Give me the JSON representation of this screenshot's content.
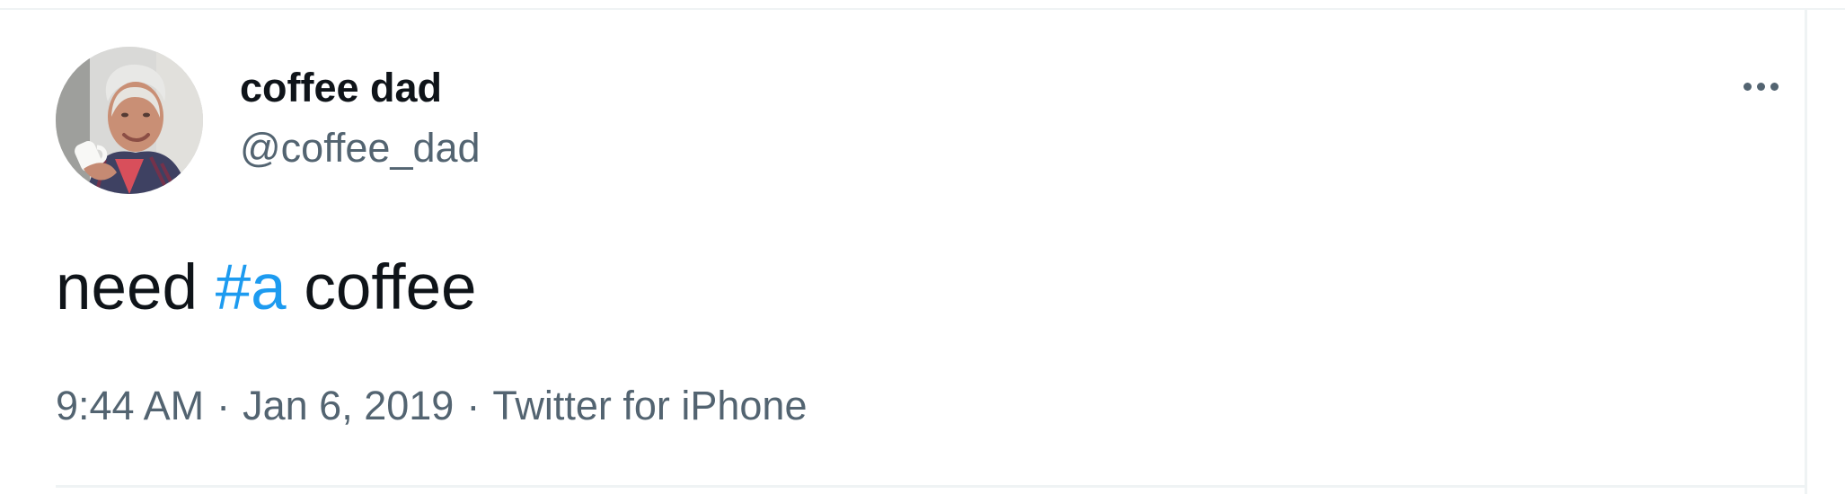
{
  "tweet": {
    "author": {
      "display_name": "coffee dad",
      "handle": "@coffee_dad",
      "avatar_icon": "person-holding-mug-avatar"
    },
    "more_icon": "more-horizontal-icon",
    "text": {
      "before": "need",
      "hashtag": "#a",
      "after": "coffee"
    },
    "meta": {
      "time": "9:44 AM",
      "separator": "·",
      "date": "Jan 6, 2019",
      "source": "Twitter for iPhone"
    }
  },
  "colors": {
    "text_primary": "#0f1419",
    "text_secondary": "#536471",
    "link_blue": "#1d9bf0",
    "border": "#eff3f4"
  }
}
